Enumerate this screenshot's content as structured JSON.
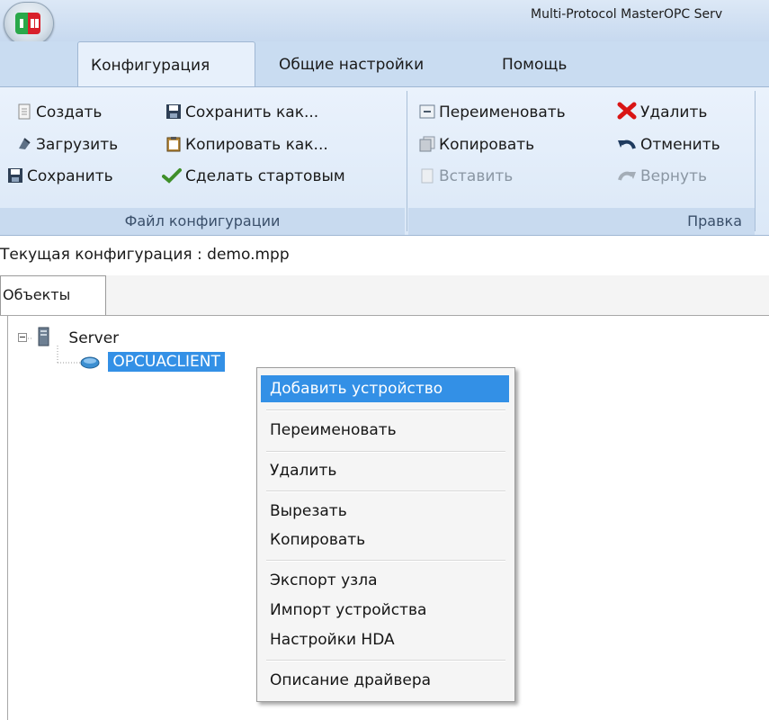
{
  "window": {
    "title": "Multi-Protocol MasterOPC Serv"
  },
  "ribbon": {
    "tabs": [
      {
        "label": "Конфигурация",
        "active": true
      },
      {
        "label": "Общие настройки",
        "active": false
      },
      {
        "label": "Помощь",
        "active": false
      }
    ],
    "file_group": {
      "caption": "Файл конфигурации",
      "create": "Создать",
      "load": "Загрузить",
      "save": "Сохранить",
      "save_as": "Сохранить как...",
      "copy_as": "Копировать как...",
      "make_startup": "Сделать стартовым"
    },
    "edit_group": {
      "caption": "Правка",
      "rename": "Переименовать",
      "copy": "Копировать",
      "paste": "Вставить",
      "delete": "Удалить",
      "undo": "Отменить",
      "redo": "Вернуть"
    }
  },
  "status": {
    "current_config": "Текущая конфигурация : demo.mpp"
  },
  "objects_tab": {
    "label": "Объекты"
  },
  "tree": {
    "root": {
      "label": "Server",
      "icon": "server-icon"
    },
    "child": {
      "label": "OPCUACLIENT",
      "icon": "opc-client-icon",
      "selected": true
    }
  },
  "context_menu": {
    "items": [
      "Добавить устройство",
      "Переименовать",
      "Удалить",
      "Вырезать",
      "Копировать",
      "Экспорт узла",
      "Импорт устройства",
      "Настройки HDA",
      "Описание драйвера"
    ],
    "highlighted": "Добавить устройство"
  },
  "colors": {
    "selection": "#3390e6",
    "ribbon_bg": "#dbe8f7",
    "delete_red": "#d91515"
  }
}
